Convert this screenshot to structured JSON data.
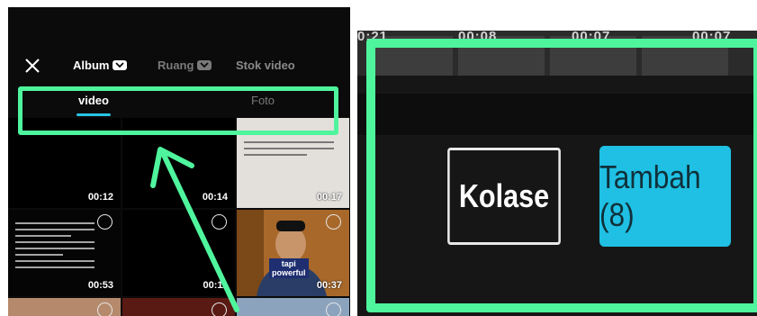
{
  "picker": {
    "tabs": [
      {
        "label": "Album"
      },
      {
        "label": "Ruang"
      },
      {
        "label": "Stok video"
      }
    ],
    "subtabs": [
      {
        "label": "video",
        "active": true
      },
      {
        "label": "Foto",
        "active": false
      }
    ],
    "grid": [
      {
        "duration": ""
      },
      {
        "duration": ""
      },
      {
        "duration": ""
      },
      {
        "duration": "00:12"
      },
      {
        "duration": "00:14"
      },
      {
        "duration": "00:17"
      },
      {
        "duration": "00:53"
      },
      {
        "duration": "00:11"
      },
      {
        "duration": "00:37"
      }
    ],
    "video_caption": {
      "line1": "tapi",
      "line2": "powerful"
    }
  },
  "editor": {
    "timestamps": [
      "0:21",
      "00:08",
      "00:07",
      "00:07"
    ],
    "kolase_label": "Kolase",
    "tambah_label": "Tambah (8)"
  },
  "colors": {
    "highlight": "#4ff59d",
    "accent": "#1fc0e3",
    "background": "#0b0b0b"
  }
}
